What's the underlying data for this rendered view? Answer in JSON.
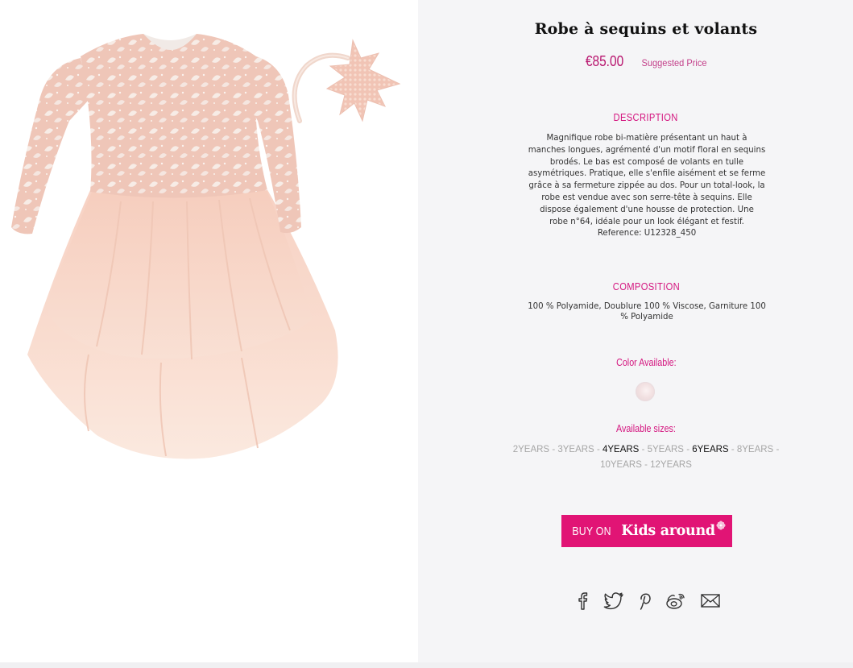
{
  "product": {
    "title": "Robe à sequins et volants",
    "price": "€85.00",
    "price_note": "Suggested Price"
  },
  "description": {
    "heading": "DESCRIPTION",
    "lines": [
      "Magnifique robe bi-matière présentant un haut à",
      "manches longues, agrémenté d'un motif floral en sequins",
      "brodés. Le bas est composé de volants en tulle",
      "asymétriques. Pratique, elle s'enfile aisément et se ferme",
      "grâce à sa fermeture zippée au dos. Pour un total-look, la",
      "robe est vendue avec son serre-tête à sequins. Elle",
      "dispose également d'une housse de protection. Une",
      "robe n°64, idéale pour un look élégant et festif.",
      "Reference: U12328_450"
    ]
  },
  "composition": {
    "heading": "COMPOSITION",
    "lines": [
      "100 % Polyamide, Doublure 100 % Viscose, Garniture 100",
      "% Polyamide"
    ]
  },
  "colors": {
    "heading": "Color Available:",
    "swatches": [
      {
        "name": "light pink",
        "hex": "#f2e1e2"
      }
    ]
  },
  "sizes": {
    "heading": "Available sizes:",
    "separator": "-",
    "row1": [
      {
        "label": "2YEARS",
        "available": false
      },
      {
        "label": "3YEARS",
        "available": false
      },
      {
        "label": "4YEARS",
        "available": true
      },
      {
        "label": "5YEARS",
        "available": false
      },
      {
        "label": "6YEARS",
        "available": true
      },
      {
        "label": "8YEARS",
        "available": false
      }
    ],
    "row2": [
      {
        "label": "10YEARS",
        "available": false
      },
      {
        "label": "12YEARS",
        "available": false
      }
    ]
  },
  "buy_button": {
    "prefix": "BUY ON",
    "brand": "Kids around"
  },
  "social": [
    {
      "name": "facebook-icon"
    },
    {
      "name": "twitter-icon"
    },
    {
      "name": "pinterest-icon"
    },
    {
      "name": "weibo-icon"
    },
    {
      "name": "email-icon"
    }
  ],
  "colors_ui": {
    "accent": "#d4157f",
    "button": "#e11475",
    "price": "#b8166f",
    "panel_bg": "#f5f5f7"
  }
}
